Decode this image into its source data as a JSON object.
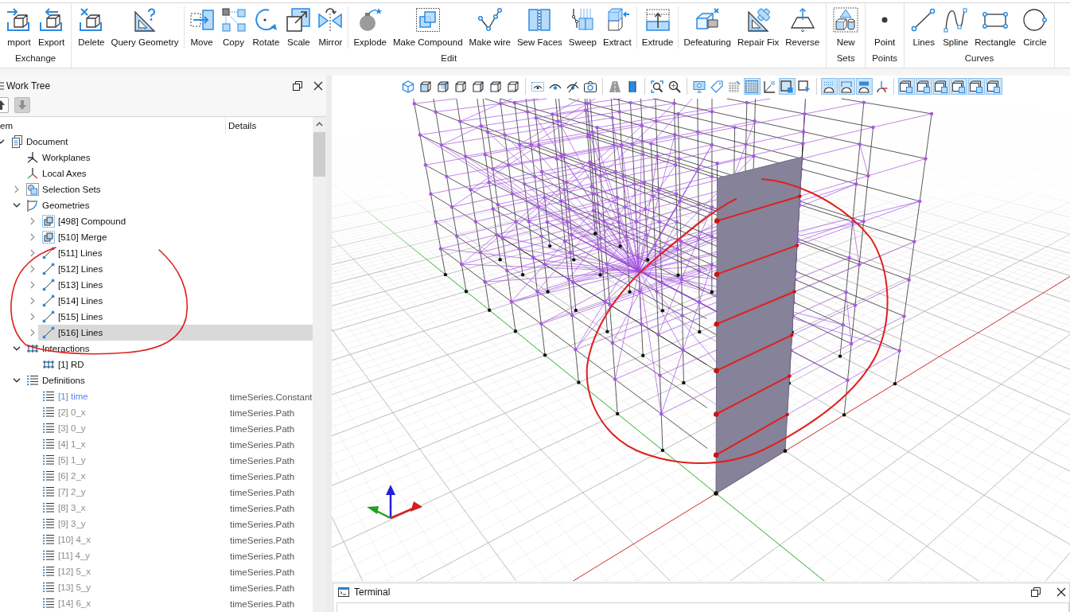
{
  "ribbon": {
    "groups": [
      {
        "label": "Exchange",
        "sections": [
          [
            {
              "label": "mport",
              "kind": "import"
            },
            {
              "label": "Export",
              "kind": "export"
            }
          ]
        ]
      },
      {
        "label": "Edit",
        "sections": [
          [
            {
              "label": "Delete",
              "kind": "delete"
            },
            {
              "label": "Query Geometry",
              "kind": "query"
            }
          ],
          [
            {
              "label": "Move",
              "kind": "move"
            },
            {
              "label": "Copy",
              "kind": "copy"
            },
            {
              "label": "Rotate",
              "kind": "rotate"
            },
            {
              "label": "Scale",
              "kind": "scale"
            },
            {
              "label": "Mirror",
              "kind": "mirror"
            }
          ],
          [
            {
              "label": "Explode",
              "kind": "explode"
            },
            {
              "label": "Make Compound",
              "kind": "compound"
            },
            {
              "label": "Make wire",
              "kind": "wire"
            },
            {
              "label": "Sew Faces",
              "kind": "sew"
            },
            {
              "label": "Sweep",
              "kind": "sweep"
            },
            {
              "label": "Extract",
              "kind": "extract"
            }
          ],
          [
            {
              "label": "Extrude",
              "kind": "extrude"
            }
          ],
          [
            {
              "label": "Defeaturing",
              "kind": "defeature"
            },
            {
              "label": "Repair Fix",
              "kind": "repair"
            },
            {
              "label": "Reverse",
              "kind": "reverse"
            }
          ]
        ]
      },
      {
        "label": "Sets",
        "sections": [
          [
            {
              "label": "New",
              "kind": "new-set"
            }
          ]
        ]
      },
      {
        "label": "Points",
        "sections": [
          [
            {
              "label": "Point",
              "kind": "point"
            }
          ]
        ]
      },
      {
        "label": "Curves",
        "sections": [
          [
            {
              "label": "Lines",
              "kind": "lines"
            },
            {
              "label": "Spline",
              "kind": "spline"
            },
            {
              "label": "Rectangle",
              "kind": "rectangle"
            },
            {
              "label": "Circle",
              "kind": "circle"
            }
          ]
        ]
      }
    ]
  },
  "work_tree": {
    "title": "Work Tree",
    "toolbar": [
      {
        "kind": "up",
        "disabled": false
      },
      {
        "kind": "down",
        "disabled": true
      }
    ],
    "columns": [
      "em",
      "Details"
    ],
    "items": [
      {
        "label": "Document",
        "kind": "document",
        "expanded": true,
        "selected": false,
        "children": [
          {
            "label": "Workplanes",
            "kind": "workplanes",
            "selected": false
          },
          {
            "label": "Local Axes",
            "kind": "axes",
            "selected": false
          },
          {
            "label": "Selection Sets",
            "kind": "selection-sets",
            "expanded": false,
            "selected": false
          },
          {
            "label": "Geometries",
            "kind": "geometries",
            "expanded": true,
            "selected": false,
            "children": [
              {
                "label": "[498] Compound",
                "kind": "compound",
                "expanded": false,
                "selected": false
              },
              {
                "label": "[510] Merge",
                "kind": "compound",
                "expanded": false,
                "selected": false
              },
              {
                "label": "[511] Lines",
                "kind": "lines",
                "expanded": false,
                "selected": false
              },
              {
                "label": "[512] Lines",
                "kind": "lines",
                "expanded": false,
                "selected": false
              },
              {
                "label": "[513] Lines",
                "kind": "lines",
                "expanded": false,
                "selected": false
              },
              {
                "label": "[514] Lines",
                "kind": "lines",
                "expanded": false,
                "selected": false
              },
              {
                "label": "[515] Lines",
                "kind": "lines",
                "expanded": false,
                "selected": false
              },
              {
                "label": "[516] Lines",
                "kind": "lines",
                "expanded": false,
                "selected": true
              }
            ]
          },
          {
            "label": "Interactions",
            "kind": "interactions",
            "expanded": true,
            "selected": false,
            "children": [
              {
                "label": "[1] RD",
                "kind": "interactions",
                "selected": false
              }
            ]
          },
          {
            "label": "Definitions",
            "kind": "definitions",
            "expanded": true,
            "selected": false,
            "children": [
              {
                "label": "[1] time",
                "kind": "definitions",
                "details": "timeSeries.Constant",
                "active": true,
                "selected": false
              },
              {
                "label": "[2] 0_x",
                "kind": "definitions",
                "details": "timeSeries.Path",
                "active": false,
                "selected": false
              },
              {
                "label": "[3] 0_y",
                "kind": "definitions",
                "details": "timeSeries.Path",
                "active": false,
                "selected": false
              },
              {
                "label": "[4] 1_x",
                "kind": "definitions",
                "details": "timeSeries.Path",
                "active": false,
                "selected": false
              },
              {
                "label": "[5] 1_y",
                "kind": "definitions",
                "details": "timeSeries.Path",
                "active": false,
                "selected": false
              },
              {
                "label": "[6] 2_x",
                "kind": "definitions",
                "details": "timeSeries.Path",
                "active": false,
                "selected": false
              },
              {
                "label": "[7] 2_y",
                "kind": "definitions",
                "details": "timeSeries.Path",
                "active": false,
                "selected": false
              },
              {
                "label": "[8] 3_x",
                "kind": "definitions",
                "details": "timeSeries.Path",
                "active": false,
                "selected": false
              },
              {
                "label": "[9] 3_y",
                "kind": "definitions",
                "details": "timeSeries.Path",
                "active": false,
                "selected": false
              },
              {
                "label": "[10] 4_x",
                "kind": "definitions",
                "details": "timeSeries.Path",
                "active": false,
                "selected": false
              },
              {
                "label": "[11] 4_y",
                "kind": "definitions",
                "details": "timeSeries.Path",
                "active": false,
                "selected": false
              },
              {
                "label": "[12] 5_x",
                "kind": "definitions",
                "details": "timeSeries.Path",
                "active": false,
                "selected": false
              },
              {
                "label": "[13] 5_y",
                "kind": "definitions",
                "details": "timeSeries.Path",
                "active": false,
                "selected": false
              },
              {
                "label": "[14] 6_x",
                "kind": "definitions",
                "details": "timeSeries.Path",
                "active": false,
                "selected": false
              }
            ]
          }
        ]
      }
    ]
  },
  "viewport": {
    "toolbar": [
      [
        {
          "kind": "view-iso",
          "on": false
        },
        {
          "kind": "view-front",
          "on": false
        },
        {
          "kind": "view-back",
          "on": false
        },
        {
          "kind": "view-left",
          "on": false
        },
        {
          "kind": "view-right",
          "on": false
        },
        {
          "kind": "view-top",
          "on": false
        },
        {
          "kind": "view-bottom",
          "on": false
        }
      ],
      [
        {
          "kind": "show-selected",
          "on": false
        },
        {
          "kind": "show",
          "on": false
        },
        {
          "kind": "hide",
          "on": false
        },
        {
          "kind": "screenshot",
          "on": false
        }
      ],
      [
        {
          "kind": "perspective",
          "on": false
        },
        {
          "kind": "orthographic",
          "on": false
        }
      ],
      [
        {
          "kind": "zoom-fit",
          "on": false
        },
        {
          "kind": "zoom",
          "on": false
        }
      ],
      [
        {
          "kind": "display-settings",
          "on": false
        },
        {
          "kind": "labels",
          "on": false
        },
        {
          "kind": "grid",
          "on": false
        },
        {
          "kind": "grid-fine",
          "on": true
        },
        {
          "kind": "angle",
          "on": false
        },
        {
          "kind": "select-box",
          "on": true
        },
        {
          "kind": "select-box-arrow",
          "on": false
        }
      ],
      [
        {
          "kind": "dome-dots",
          "on": true
        },
        {
          "kind": "dome-wire",
          "on": true
        },
        {
          "kind": "dome-solid",
          "on": true
        },
        {
          "kind": "local-axes",
          "on": false
        }
      ],
      [
        {
          "kind": "display",
          "on": true
        },
        {
          "kind": "display",
          "on": true
        },
        {
          "kind": "display",
          "on": true
        },
        {
          "kind": "display",
          "on": true
        },
        {
          "kind": "display",
          "on": true
        },
        {
          "kind": "display",
          "on": true
        }
      ]
    ]
  },
  "terminal": {
    "title": "Terminal"
  }
}
